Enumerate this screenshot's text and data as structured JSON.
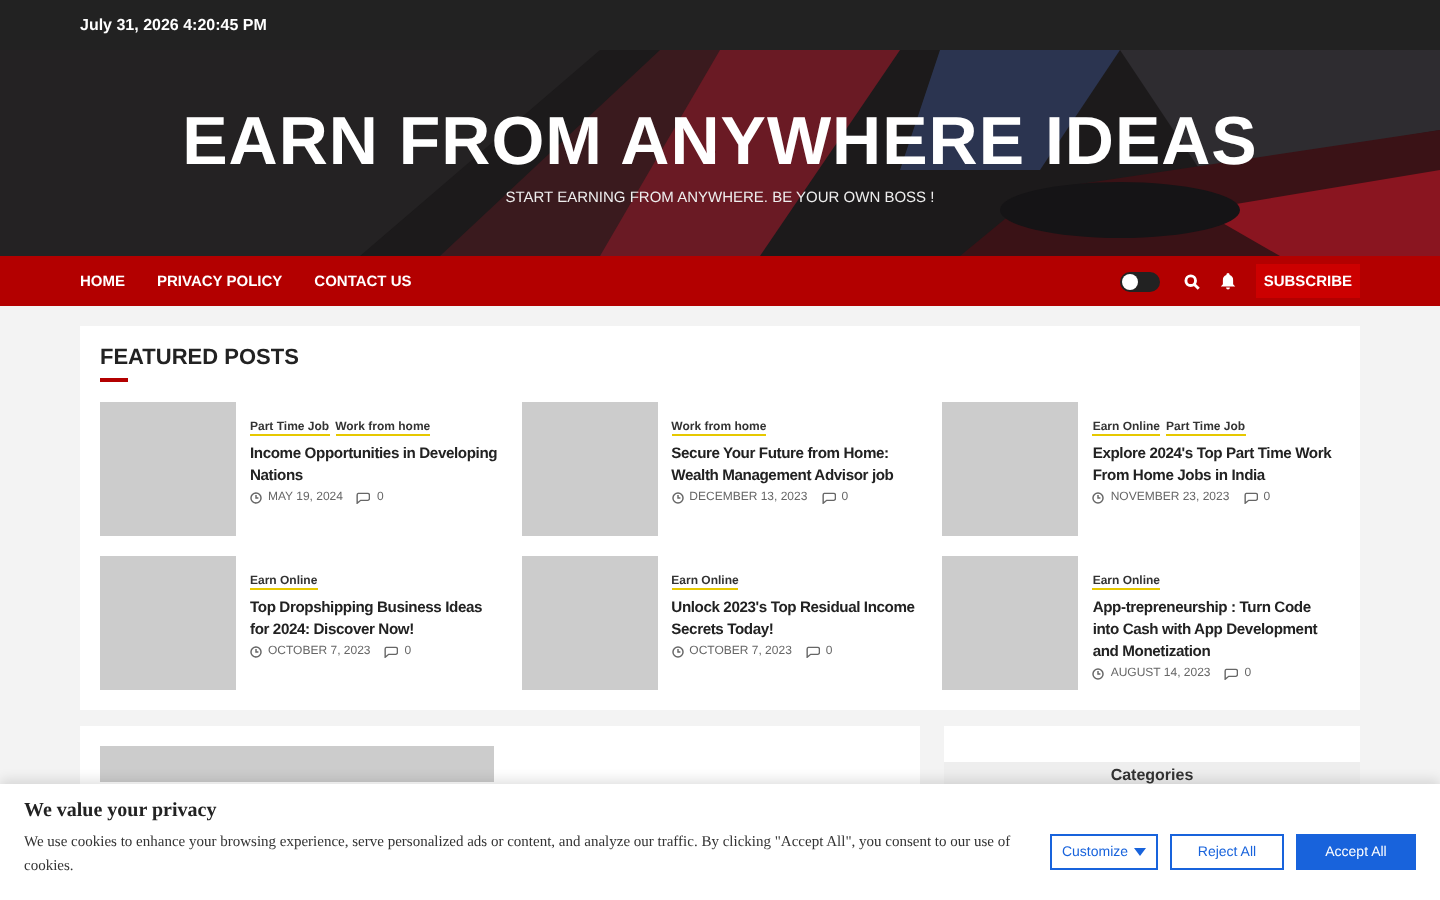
{
  "top_bar": {
    "datetime": "July 31, 2026 4:20:45 PM"
  },
  "header": {
    "title": "EARN FROM ANYWHERE IDEAS",
    "tagline": "START EARNING FROM ANYWHERE. BE YOUR OWN BOSS !"
  },
  "nav": {
    "items": [
      "HOME",
      "PRIVACY POLICY",
      "CONTACT US"
    ],
    "dark_mode": {
      "on": false
    },
    "subscribe": "SUBSCRIBE"
  },
  "featured": {
    "title": "FEATURED POSTS",
    "posts": [
      {
        "categories": [
          "Part Time Job",
          "Work from home"
        ],
        "title": "Income Opportunities in Developing Nations",
        "date": "MAY 19, 2024",
        "comments": "0"
      },
      {
        "categories": [
          "Work from home"
        ],
        "title": "Secure Your Future from Home: Wealth Management Advisor job",
        "date": "DECEMBER 13, 2023",
        "comments": "0"
      },
      {
        "categories": [
          "Earn Online",
          "Part Time Job"
        ],
        "title": "Explore 2024's Top Part Time Work From Home Jobs in India",
        "date": "NOVEMBER 23, 2023",
        "comments": "0"
      },
      {
        "categories": [
          "Earn Online"
        ],
        "title": "Top Dropshipping Business Ideas for 2024: Discover Now!",
        "date": "OCTOBER 7, 2023",
        "comments": "0"
      },
      {
        "categories": [
          "Earn Online"
        ],
        "title": "Unlock 2023's Top Residual Income Secrets Today!",
        "date": "OCTOBER 7, 2023",
        "comments": "0"
      },
      {
        "categories": [
          "Earn Online"
        ],
        "title": "App-trepreneurship : Turn Code into Cash with App Development and Monetization",
        "date": "AUGUST 14, 2023",
        "comments": "0"
      }
    ]
  },
  "sidebar": {
    "widget_title": "Categories"
  },
  "cookie_banner": {
    "title": "We value your privacy",
    "text": "We use cookies to enhance your browsing experience, serve personalized ads or content, and analyze our traffic. By clicking \"Accept All\", you consent to our use of cookies.",
    "buttons": [
      "Customize",
      "Reject All",
      "Accept All"
    ]
  }
}
